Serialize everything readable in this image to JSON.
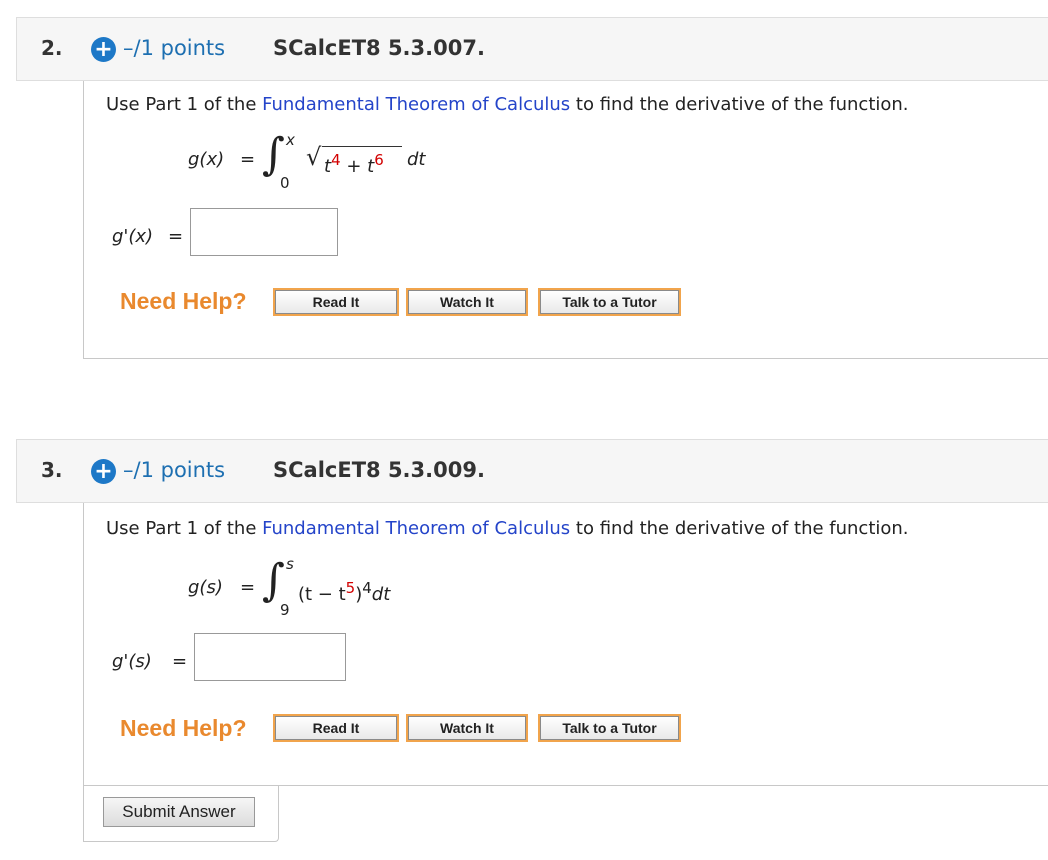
{
  "questions": [
    {
      "number": "2.",
      "points": "–/1 points",
      "code": "SCalcET8 5.3.007.",
      "prompt_before": "Use Part 1 of the ",
      "prompt_link": "Fundamental Theorem of Calculus",
      "prompt_after": " to find the derivative of the function.",
      "lhs": "g(x)",
      "eq": "=",
      "upper": "x",
      "lower": "0",
      "integrand_a": "t",
      "exp_a": "4",
      "plus": " + ",
      "integrand_b": "t",
      "exp_b": "6",
      "dt": "dt",
      "answer_label": "g'(x)",
      "answer_eq": "=",
      "answer_value": ""
    },
    {
      "number": "3.",
      "points": "–/1 points",
      "code": "SCalcET8 5.3.009.",
      "prompt_before": "Use Part 1 of the ",
      "prompt_link": "Fundamental Theorem of Calculus",
      "prompt_after": " to find the derivative of the function.",
      "lhs": "g(s)",
      "eq": "=",
      "upper": "s",
      "lower": "9",
      "integrand_open": "(t − t",
      "exp_inner": "5",
      "integrand_close": ")",
      "exp_outer": "4",
      "dt": "dt",
      "answer_label": "g'(s)",
      "answer_eq": "=",
      "answer_value": ""
    }
  ],
  "help": {
    "label": "Need Help?",
    "read_it": "Read It",
    "watch_it": "Watch It",
    "talk_tutor": "Talk to a Tutor"
  },
  "submit_label": "Submit Answer",
  "colors": {
    "link": "#2444c9",
    "points": "#1d6fb1",
    "red_value": "#d20000",
    "need_help": "#e9892e",
    "button_border": "#f1a44c"
  }
}
